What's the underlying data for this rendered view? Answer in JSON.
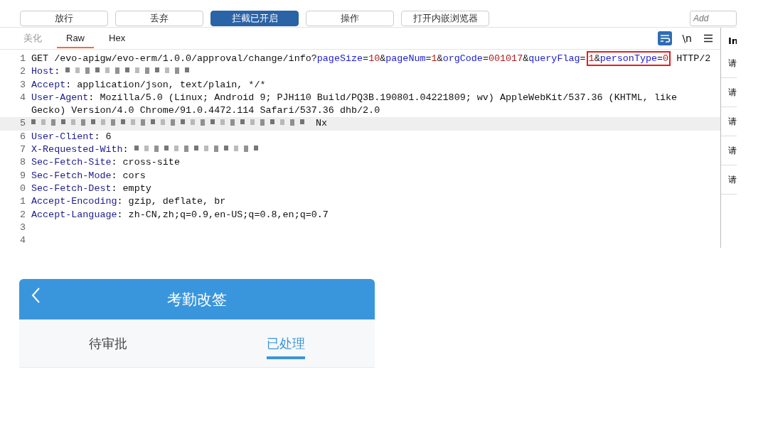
{
  "toolbar": {
    "buttons": [
      {
        "label": "放行",
        "selected": false
      },
      {
        "label": "丢弃",
        "selected": false
      },
      {
        "label": "拦截已开启",
        "selected": true
      },
      {
        "label": "操作",
        "selected": false
      },
      {
        "label": "打开内嵌浏览器",
        "selected": false
      }
    ],
    "search": {
      "placeholder": "Add"
    }
  },
  "editor": {
    "tabs": [
      {
        "label": "美化",
        "selected": false,
        "disabled": true
      },
      {
        "label": "Raw",
        "selected": true,
        "disabled": false
      },
      {
        "label": "Hex",
        "selected": false,
        "disabled": false
      }
    ],
    "wrap_on": true,
    "newline_label": "\\n",
    "lines": [
      {
        "number": "1",
        "current": false,
        "parts": [
          {
            "kind": "text",
            "text": "GET /evo-apigw/evo-erm/1.0.0/approval/change/info?"
          },
          {
            "kind": "param",
            "text": "pageSize"
          },
          {
            "kind": "text",
            "text": "="
          },
          {
            "kind": "value",
            "text": "10"
          },
          {
            "kind": "text",
            "text": "&"
          },
          {
            "kind": "param",
            "text": "pageNum"
          },
          {
            "kind": "text",
            "text": "="
          },
          {
            "kind": "value",
            "text": "1"
          },
          {
            "kind": "text",
            "text": "&"
          },
          {
            "kind": "param",
            "text": "orgCode"
          },
          {
            "kind": "text",
            "text": "="
          },
          {
            "kind": "value",
            "text": "001017"
          },
          {
            "kind": "text",
            "text": "&"
          },
          {
            "kind": "param",
            "text": "queryFlag"
          },
          {
            "kind": "text",
            "text": "="
          },
          {
            "kind": "highlight",
            "parts": [
              {
                "kind": "value",
                "text": "1"
              },
              {
                "kind": "text",
                "text": "&"
              },
              {
                "kind": "param",
                "text": "personType"
              },
              {
                "kind": "text",
                "text": "="
              },
              {
                "kind": "value",
                "text": "0"
              }
            ]
          },
          {
            "kind": "text",
            "text": " HTTP/2"
          }
        ]
      },
      {
        "number": "2",
        "current": false,
        "parts": [
          {
            "kind": "key",
            "text": "Host"
          },
          {
            "kind": "text",
            "text": ": "
          },
          {
            "kind": "blur"
          }
        ]
      },
      {
        "number": "3",
        "current": false,
        "parts": [
          {
            "kind": "key",
            "text": "Accept"
          },
          {
            "kind": "text",
            "text": ": application/json, text/plain, */*"
          }
        ]
      },
      {
        "number": "4",
        "current": false,
        "parts": [
          {
            "kind": "key",
            "text": "User-Agent"
          },
          {
            "kind": "text",
            "text": ": Mozilla/5.0 (Linux; Android 9; PJH110 Build/PQ3B.190801.04221809; wv) AppleWebKit/537.36 (KHTML, like"
          },
          {
            "kind": "break"
          },
          {
            "kind": "text",
            "text": "Gecko) Version/4.0 Chrome/91.0.4472.114 Safari/537.36 dhb/2.0"
          }
        ]
      },
      {
        "number": "5",
        "current": true,
        "parts": [
          {
            "kind": "blur"
          },
          {
            "kind": "text",
            "text": "Nx"
          }
        ]
      },
      {
        "number": "6",
        "current": false,
        "parts": [
          {
            "kind": "key",
            "text": "User-Client"
          },
          {
            "kind": "text",
            "text": ": 6"
          }
        ]
      },
      {
        "number": "7",
        "current": false,
        "parts": [
          {
            "kind": "key",
            "text": "X-Requested-With"
          },
          {
            "kind": "text",
            "text": ": "
          },
          {
            "kind": "blur"
          }
        ]
      },
      {
        "number": "8",
        "current": false,
        "parts": [
          {
            "kind": "key",
            "text": "Sec-Fetch-Site"
          },
          {
            "kind": "text",
            "text": ": cross-site"
          }
        ]
      },
      {
        "number": "9",
        "current": false,
        "parts": [
          {
            "kind": "key",
            "text": "Sec-Fetch-Mode"
          },
          {
            "kind": "text",
            "text": ": cors"
          }
        ]
      },
      {
        "number": "0",
        "current": false,
        "parts": [
          {
            "kind": "key",
            "text": "Sec-Fetch-Dest"
          },
          {
            "kind": "text",
            "text": ": empty"
          }
        ]
      },
      {
        "number": "1",
        "current": false,
        "parts": [
          {
            "kind": "key",
            "text": "Accept-Encoding"
          },
          {
            "kind": "text",
            "text": ": gzip, deflate, br"
          }
        ]
      },
      {
        "number": "2",
        "current": false,
        "parts": [
          {
            "kind": "key",
            "text": "Accept-Language"
          },
          {
            "kind": "text",
            "text": ": zh-CN,zh;q=0.9,en-US;q=0.8,en;q=0.7"
          }
        ]
      },
      {
        "number": "3",
        "current": false
      },
      {
        "number": "4",
        "current": false
      }
    ]
  },
  "side_panel": {
    "heading": "In",
    "items": [
      "请",
      "请",
      "请",
      "请",
      "请"
    ]
  },
  "app": {
    "title": "考勤改签",
    "tabs": [
      {
        "label": "待审批",
        "selected": false
      },
      {
        "label": "已处理",
        "selected": true
      }
    ]
  }
}
